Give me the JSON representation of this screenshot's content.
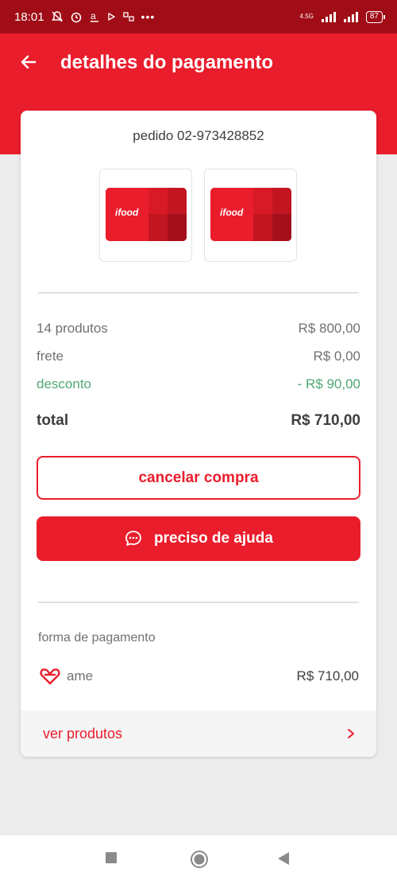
{
  "status_bar": {
    "time": "18:01",
    "network": "4.5G",
    "battery": "87"
  },
  "header": {
    "title": "detalhes do pagamento"
  },
  "order": {
    "id_label": "pedido 02-973428852",
    "products": [
      {
        "card_logo": "ifood"
      },
      {
        "card_logo": "ifood"
      }
    ]
  },
  "summary": {
    "products_label": "14 produtos",
    "products_value": "R$ 800,00",
    "shipping_label": "frete",
    "shipping_value": "R$ 0,00",
    "discount_label": "desconto",
    "discount_value": "- R$ 90,00",
    "total_label": "total",
    "total_value": "R$ 710,00"
  },
  "actions": {
    "cancel_label": "cancelar compra",
    "help_label": "preciso de ajuda"
  },
  "payment": {
    "section_label": "forma de pagamento",
    "method": "ame",
    "amount": "R$ 710,00"
  },
  "footer_link": {
    "label": "ver produtos"
  },
  "colors": {
    "primary": "#ea1d2c",
    "status_bar": "#a00d16",
    "discount": "#50a773",
    "text_dark": "#3f3e3e",
    "text_muted": "#717171"
  },
  "icons": {
    "back": "arrow-left-icon",
    "help": "chat-bubble-icon",
    "payment": "ame-heart-icon",
    "chevron": "chevron-right-icon"
  }
}
